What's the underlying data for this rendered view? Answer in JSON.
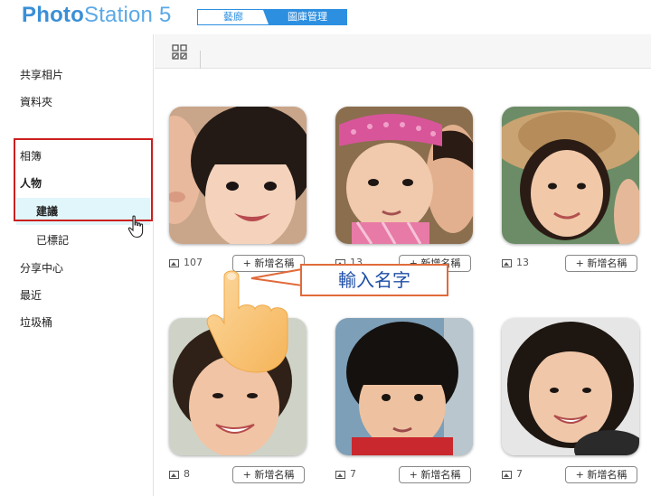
{
  "header": {
    "logo_bold": "Photo",
    "logo_light": "Station 5",
    "mode_tabs": [
      "藝廊",
      "圖庫管理"
    ]
  },
  "sidebar": {
    "items": [
      "共享相片",
      "資料夾",
      "相簿",
      "人物",
      "分享中心",
      "最近",
      "垃圾桶"
    ],
    "people_sub": [
      "建議",
      "已標記"
    ],
    "selected_sub": "建議"
  },
  "toolbar": {
    "grid_icon": "grid-view-icon"
  },
  "cards": [
    {
      "count": "107",
      "action": "+ 新增名稱"
    },
    {
      "count": "13",
      "action": "+ 新增名稱"
    },
    {
      "count": "13",
      "action": "+ 新增名稱"
    },
    {
      "count": "8",
      "action": "+ 新增名稱"
    },
    {
      "count": "7",
      "action": "+ 新增名稱"
    },
    {
      "count": "7",
      "action": "+ 新增名稱"
    }
  ],
  "callout": {
    "text": "輸入名字"
  },
  "colors": {
    "accent": "#2d8fe0",
    "highlight": "#cc1f1f",
    "callout_border": "#e06a3a",
    "callout_text": "#1f4fa8",
    "selected_bg": "#e0f6fb"
  }
}
